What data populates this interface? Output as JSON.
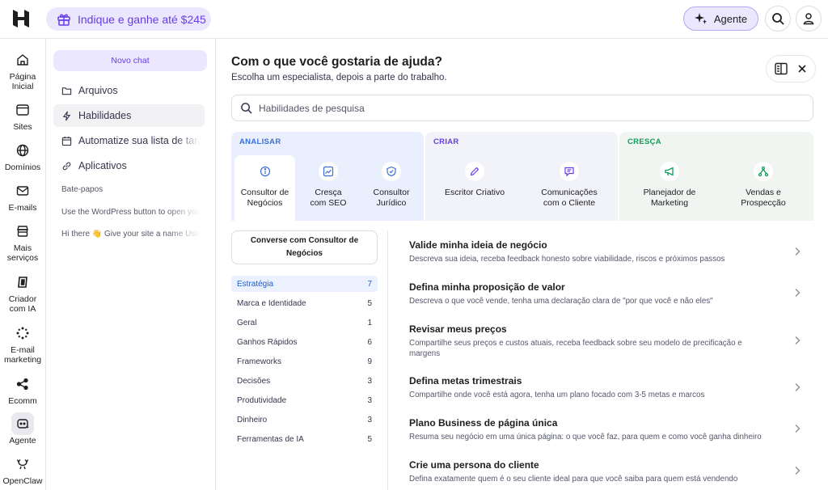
{
  "header": {
    "promo_label": "Indique e ganhe até $245",
    "agent_label": "Agente",
    "icons": [
      "hostinger-logo",
      "gift-icon",
      "sparkle-icon",
      "search-icon",
      "user-icon"
    ]
  },
  "rail": {
    "items": [
      {
        "label": "Página Inicial",
        "icon": "home-icon"
      },
      {
        "label": "Sites",
        "icon": "browser-icon"
      },
      {
        "label": "Domínios",
        "icon": "globe-icon"
      },
      {
        "label": "E-mails",
        "icon": "mail-icon"
      },
      {
        "label": "Mais serviços",
        "icon": "store-icon"
      },
      {
        "label": "Criador com IA",
        "icon": "ai-builder-icon"
      },
      {
        "label": "E-mail marketing",
        "icon": "sparkle-burst-icon"
      },
      {
        "label": "Ecomm",
        "icon": "share-icon"
      },
      {
        "label": "Agente",
        "icon": "agent-icon",
        "active": true
      },
      {
        "label": "OpenClaw",
        "icon": "claw-icon"
      }
    ]
  },
  "chat_panel": {
    "new_chat_label": "Novo chat",
    "menu": [
      {
        "label": "Arquivos",
        "icon": "folder-icon"
      },
      {
        "label": "Habilidades",
        "icon": "bolt-icon",
        "active": true
      },
      {
        "label": "Automatize sua lista de tarefas",
        "icon": "calendar-icon"
      },
      {
        "label": "Aplicativos",
        "icon": "link-icon"
      }
    ],
    "section_label": "Bate-papos",
    "chats": [
      "Use the WordPress button to open your site",
      "Hi there 👋 Give your site a name Using"
    ]
  },
  "main": {
    "title": "Com o que você gostaria de ajuda?",
    "subtitle": "Escolha um especialista, depois a parte do trabalho.",
    "search_placeholder": "Habilidades de pesquisa",
    "groups": [
      {
        "title": "ANALISAR",
        "color": "#3b6fd8",
        "bg": "#e9effc",
        "tiles": [
          {
            "label": "Consultor de Negócios",
            "icon": "info-icon",
            "selected": true
          },
          {
            "label": "Cresça com SEO",
            "icon": "trend-icon"
          },
          {
            "label": "Consultor Jurídico",
            "icon": "shield-icon"
          }
        ]
      },
      {
        "title": "CRIAR",
        "color": "#673de6",
        "bg": "#f2f2f9",
        "tiles": [
          {
            "label": "Escritor Criativo",
            "icon": "pen-icon"
          },
          {
            "label": "Comunicações com o Cliente",
            "icon": "chat-icon"
          }
        ]
      },
      {
        "title": "CRESÇA",
        "color": "#0f9d58",
        "bg": "#f0f5f1",
        "tiles": [
          {
            "label": "Planejador de Marketing",
            "icon": "megaphone-icon"
          },
          {
            "label": "Vendas e Prospecção",
            "icon": "network-icon"
          }
        ]
      }
    ],
    "consult_button": "Converse com Consultor de Negócios",
    "categories": [
      {
        "label": "Estratégia",
        "count": "7",
        "active": true
      },
      {
        "label": "Marca e Identidade",
        "count": "5"
      },
      {
        "label": "Geral",
        "count": "1"
      },
      {
        "label": "Ganhos Rápidos",
        "count": "6"
      },
      {
        "label": "Frameworks",
        "count": "9"
      },
      {
        "label": "Decisões",
        "count": "3"
      },
      {
        "label": "Produtividade",
        "count": "3"
      },
      {
        "label": "Dinheiro",
        "count": "3"
      },
      {
        "label": "Ferramentas de IA",
        "count": "5"
      }
    ],
    "skills": [
      {
        "title": "Valide minha ideia de negócio",
        "desc": "Descreva sua ideia, receba feedback honesto sobre viabilidade, riscos e próximos passos"
      },
      {
        "title": "Defina minha proposição de valor",
        "desc": "Descreva o que você vende, tenha uma declaração clara de \"por que você e não eles\""
      },
      {
        "title": "Revisar meus preços",
        "desc": "Compartilhe seus preços e custos atuais, receba feedback sobre seu modelo de precificação e margens"
      },
      {
        "title": "Defina metas trimestrais",
        "desc": "Compartilhe onde você está agora, tenha um plano focado com 3-5 metas e marcos"
      },
      {
        "title": "Plano Business de página única",
        "desc": "Resuma seu negócio em uma única página: o que você faz, para quem e como você ganha dinheiro"
      },
      {
        "title": "Crie uma persona do cliente",
        "desc": "Defina exatamente quem é o seu cliente ideal para que você saiba para quem está vendendo"
      }
    ]
  }
}
